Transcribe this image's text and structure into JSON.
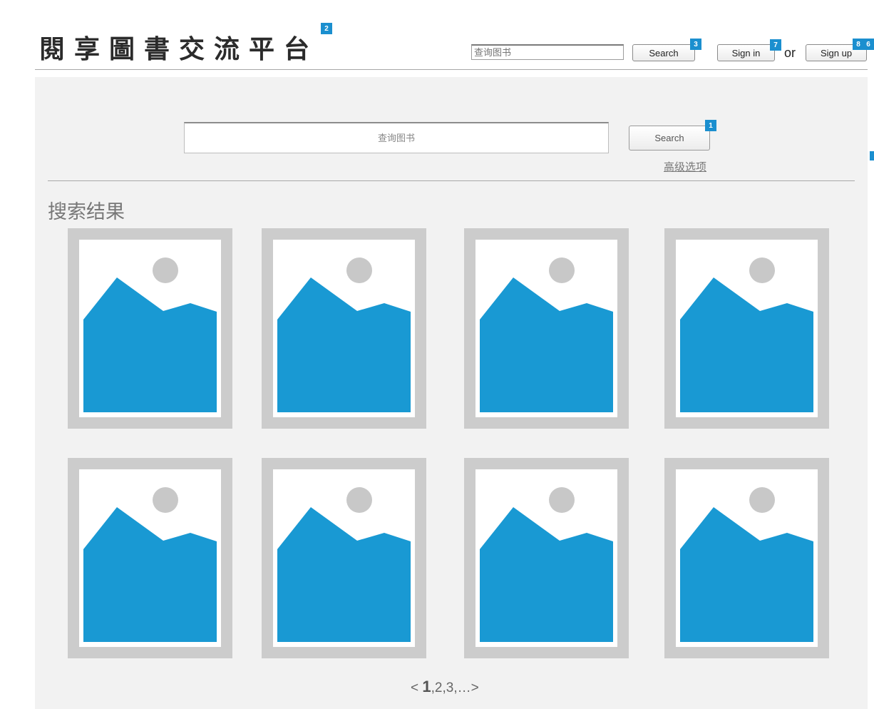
{
  "header": {
    "logo_text": "閱享圖書交流平台",
    "search_placeholder": "查询图书",
    "search_button": "Search",
    "sign_in": "Sign in",
    "or_text": "or",
    "sign_up": "Sign up"
  },
  "main": {
    "search_placeholder": "查询图书",
    "search_button": "Search",
    "advanced_link": "高级选项",
    "results_title": "搜索结果",
    "results": [
      {
        "image": "image-placeholder-icon"
      },
      {
        "image": "image-placeholder-icon"
      },
      {
        "image": "image-placeholder-icon"
      },
      {
        "image": "image-placeholder-icon"
      },
      {
        "image": "image-placeholder-icon"
      },
      {
        "image": "image-placeholder-icon"
      },
      {
        "image": "image-placeholder-icon"
      },
      {
        "image": "image-placeholder-icon"
      }
    ],
    "pagination": {
      "prev": "<",
      "current": "1",
      "pages": [
        ",2",
        ",3",
        ",…"
      ],
      "next": ">"
    }
  },
  "annotations": {
    "badge_logo": "2",
    "badge_header_search": "3",
    "badge_sign_in": "7",
    "badge_sign_up_a": "8",
    "badge_sign_up_b": "6",
    "badge_main_search": "1"
  },
  "colors": {
    "accent": "#1b8fcf",
    "panel": "#f2f2f2",
    "card_frame": "#cccccc",
    "image_fill": "#1999d3",
    "image_sun": "#c8c8c8"
  }
}
